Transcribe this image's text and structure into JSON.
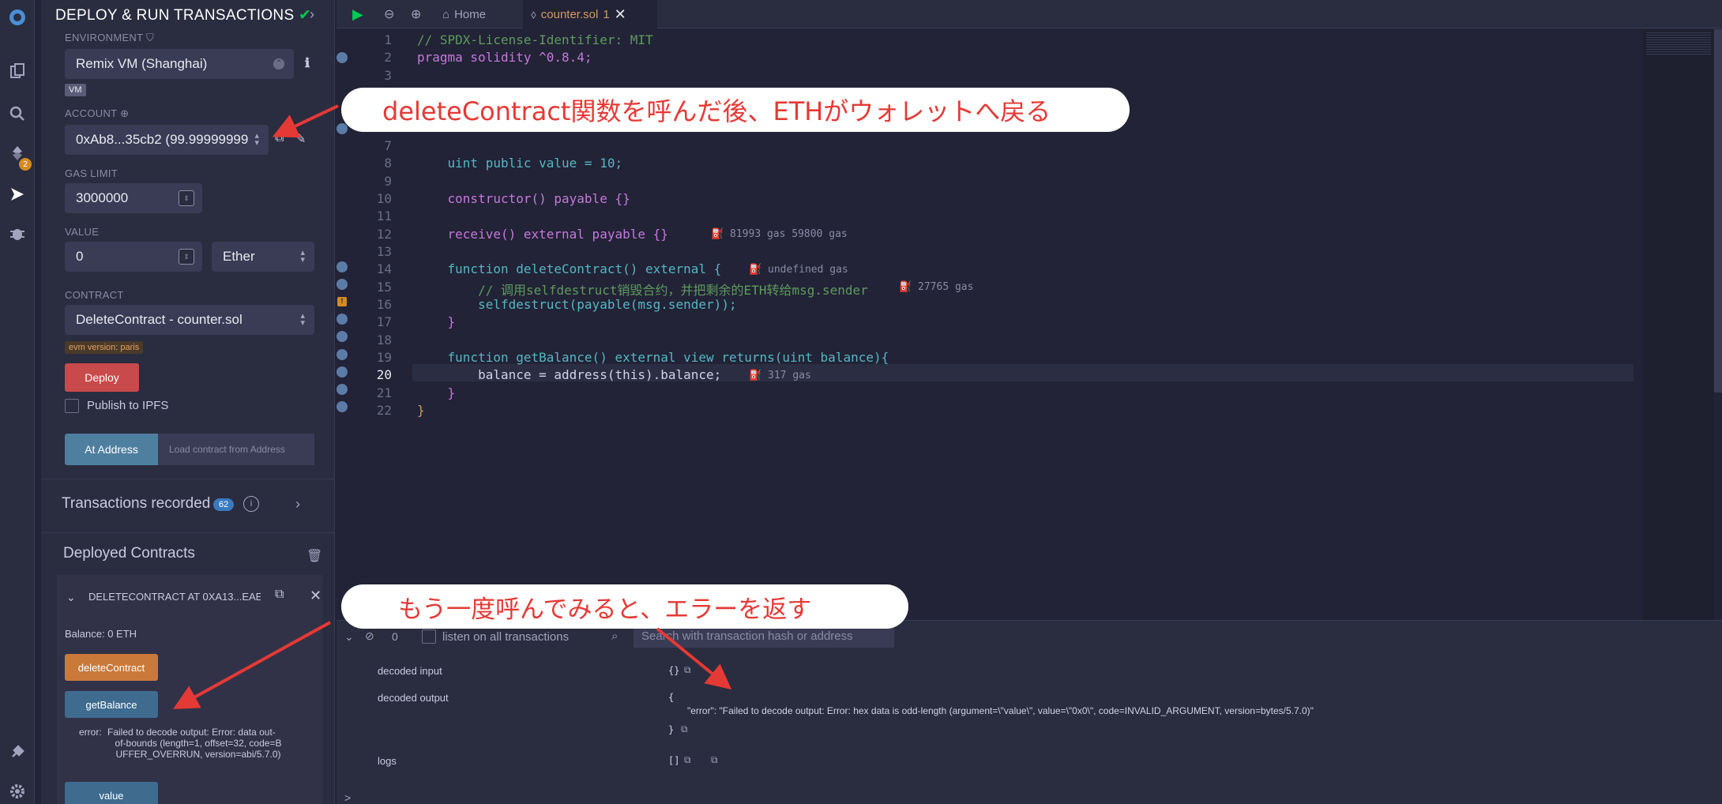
{
  "rail": {
    "plugin_badge": "2"
  },
  "panel": {
    "title": "DEPLOY & RUN TRANSACTIONS",
    "environment_label": "ENVIRONMENT",
    "environment_value": "Remix VM (Shanghai)",
    "vm_tag": "VM",
    "account_label": "ACCOUNT",
    "account_value": "0xAb8...35cb2 (99.99999999",
    "gas_limit_label": "GAS LIMIT",
    "gas_limit_value": "3000000",
    "value_label": "VALUE",
    "value_amount": "0",
    "value_unit": "Ether",
    "contract_label": "CONTRACT",
    "contract_value": "DeleteContract - counter.sol",
    "evm_tag": "evm version: paris",
    "deploy_button": "Deploy",
    "publish_ipfs": "Publish to IPFS",
    "at_address_button": "At Address",
    "load_contract_placeholder": "Load contract from Address",
    "transactions_recorded": "Transactions recorded",
    "transactions_count": "62",
    "deployed_contracts": "Deployed Contracts",
    "instance_name": "DELETECONTRACT AT 0XA13...EAE",
    "balance": "Balance: 0 ETH",
    "delete_button": "deleteContract",
    "getbalance_button": "getBalance",
    "error_label": "error:",
    "error_lines": [
      "Failed to decode output: Error: data out-",
      "of-bounds (length=1, offset=32, code=B",
      "UFFER_OVERRUN, version=abi/5.7.0)"
    ],
    "value_button": "value"
  },
  "tabs": {
    "home": "Home",
    "file": "counter.sol",
    "file_badge": "1"
  },
  "editor": {
    "lines": [
      {
        "n": "1",
        "text": "// SPDX-License-Identifier: MIT"
      },
      {
        "n": "2",
        "text": "pragma solidity ^0.8.4;"
      },
      {
        "n": "3",
        "text": ""
      },
      {
        "n": "7",
        "text": ""
      },
      {
        "n": "8",
        "text": "    uint public value = 10;"
      },
      {
        "n": "9",
        "text": ""
      },
      {
        "n": "10",
        "text": "    constructor() payable {}"
      },
      {
        "n": "11",
        "text": ""
      },
      {
        "n": "12",
        "text": "    receive() external payable {}"
      },
      {
        "n": "13",
        "text": ""
      },
      {
        "n": "14",
        "text": "    function deleteContract() external {"
      },
      {
        "n": "15",
        "text": "        // 调用selfdestruct销毁合约，并把剩余的ETH转给msg.sender"
      },
      {
        "n": "16",
        "text": "        selfdestruct(payable(msg.sender));"
      },
      {
        "n": "17",
        "text": "    }"
      },
      {
        "n": "18",
        "text": ""
      },
      {
        "n": "19",
        "text": "    function getBalance() external view returns(uint balance){"
      },
      {
        "n": "20",
        "text": "        balance = address(this).balance;"
      },
      {
        "n": "21",
        "text": "    }"
      },
      {
        "n": "22",
        "text": "}"
      }
    ],
    "gas_12": "81993 gas 59800 gas",
    "gas_14": "undefined gas",
    "gas_15": "27765 gas",
    "gas_20": "317 gas"
  },
  "terminal": {
    "count": "0",
    "listen_label": "listen on all transactions",
    "search_placeholder": "Search with transaction hash or address",
    "decoded_input_label": "decoded input",
    "decoded_input_value": "{}",
    "decoded_output_label": "decoded output",
    "output_open": "{",
    "output_error": "\"error\": \"Failed to decode output: Error: hex data is odd-length (argument=\\\"value\\\", value=\\\"0x0\\\", code=INVALID_ARGUMENT, version=bytes/5.7.0)\"",
    "output_close": "}",
    "logs_label": "logs",
    "logs_value": "[]",
    "prompt": ">"
  },
  "callouts": {
    "top": "deleteContract関数を呼んだ後、ETHがウォレットへ戻る",
    "bottom": "もう一度呼んでみると、エラーを返す"
  },
  "colors": {
    "deploy_button": "#c94a4a",
    "delete_button": "#c97a3a",
    "getbalance_button": "#3f6b8f",
    "at_address_button": "#4f7f9f",
    "callout_text": "#e53935",
    "arrow": "#e53935"
  }
}
